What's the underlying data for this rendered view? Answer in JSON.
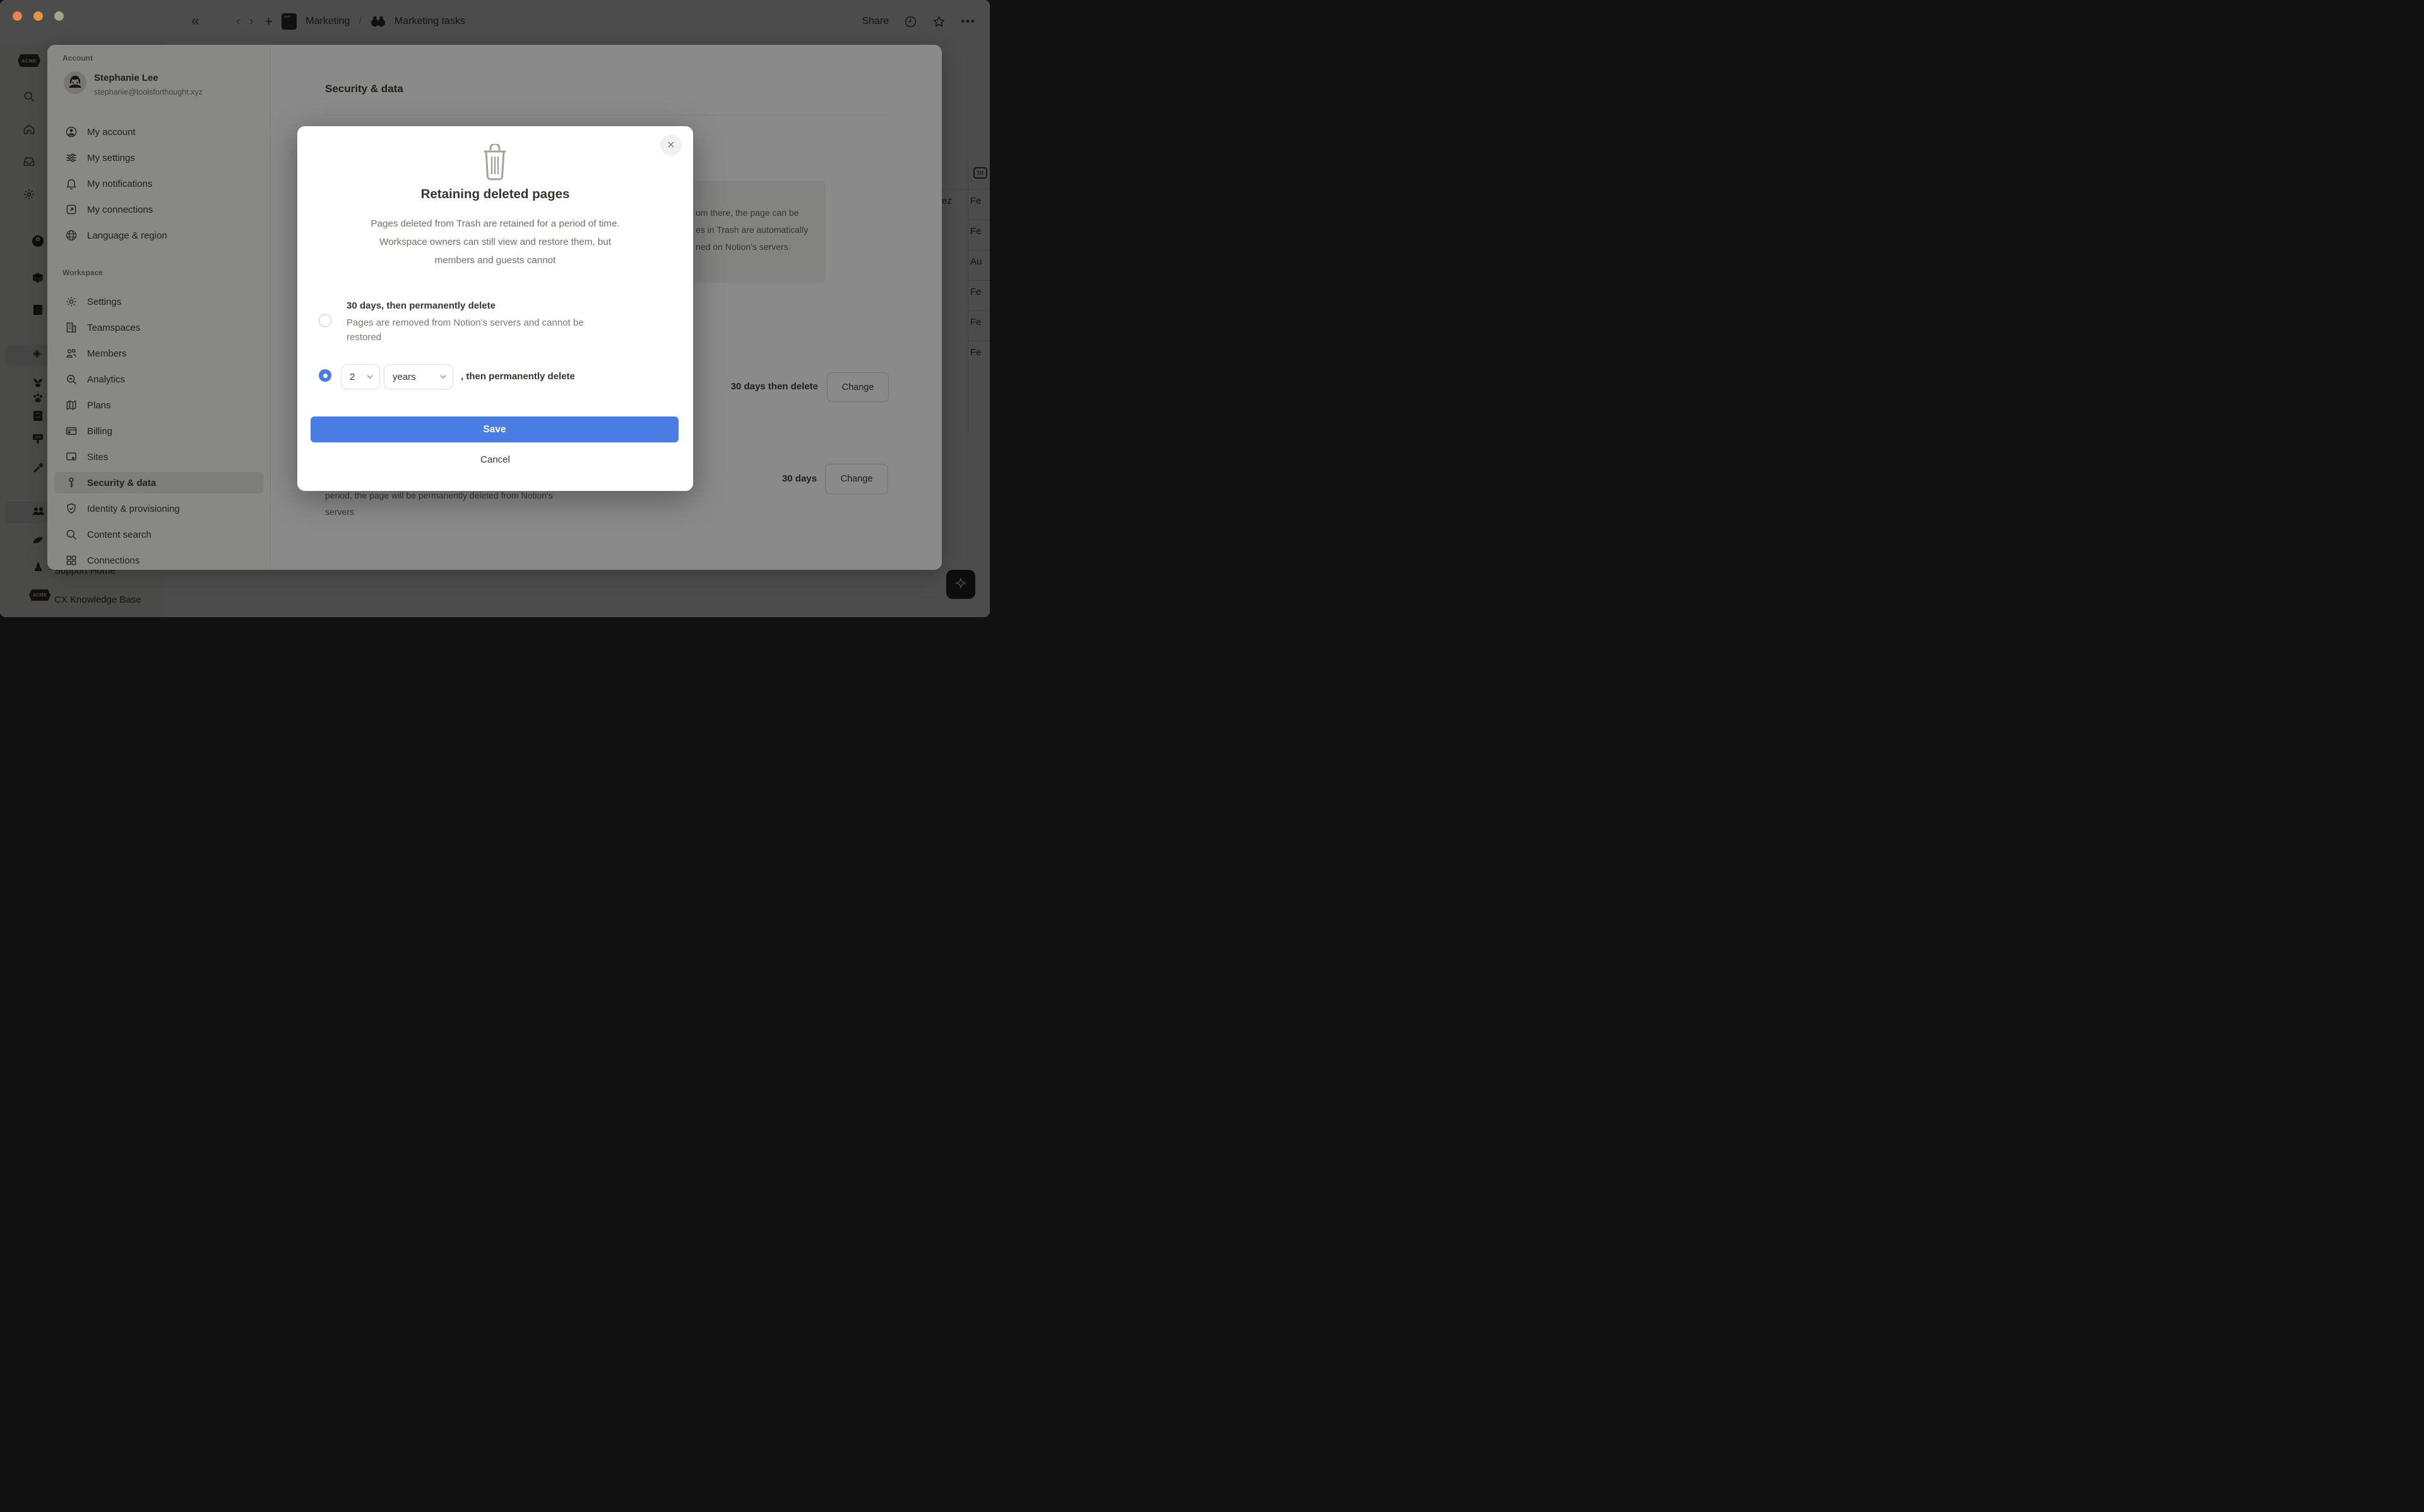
{
  "topbar": {
    "breadcrumb": {
      "page": "Marketing",
      "separator": "/",
      "subpage": "Marketing tasks"
    },
    "share_label": "Share"
  },
  "base_app": {
    "workspace_badge": "ACME",
    "sidebar_bottom_items": [
      {
        "label": "Support Home"
      },
      {
        "label": "CX Knowledge Base"
      }
    ],
    "table": {
      "name_fragment": "ez",
      "date_fragments": [
        "Fe",
        "Fe",
        "Au",
        "Fe",
        "Fe",
        "Fe"
      ]
    }
  },
  "settings": {
    "sidebar": {
      "account_label": "Account",
      "user": {
        "name": "Stephanie Lee",
        "email": "stephanie@toolsforthought.xyz"
      },
      "account_items": [
        {
          "label": "My account",
          "icon": "user-circle-icon"
        },
        {
          "label": "My settings",
          "icon": "sliders-icon"
        },
        {
          "label": "My notifications",
          "icon": "bell-icon"
        },
        {
          "label": "My connections",
          "icon": "external-link-icon"
        },
        {
          "label": "Language & region",
          "icon": "globe-icon"
        }
      ],
      "workspace_label": "Workspace",
      "workspace_items": [
        {
          "label": "Settings",
          "icon": "gear-icon",
          "selected": false
        },
        {
          "label": "Teamspaces",
          "icon": "building-icon",
          "selected": false
        },
        {
          "label": "Members",
          "icon": "members-icon",
          "selected": false
        },
        {
          "label": "Analytics",
          "icon": "analytics-icon",
          "selected": false
        },
        {
          "label": "Plans",
          "icon": "map-icon",
          "selected": false
        },
        {
          "label": "Billing",
          "icon": "credit-card-icon",
          "selected": false
        },
        {
          "label": "Sites",
          "icon": "browser-icon",
          "selected": false
        },
        {
          "label": "Security & data",
          "icon": "key-icon",
          "selected": true
        },
        {
          "label": "Identity & provisioning",
          "icon": "shield-check-icon",
          "selected": false
        },
        {
          "label": "Content search",
          "icon": "search-icon",
          "selected": false
        },
        {
          "label": "Connections",
          "icon": "grid-icon",
          "selected": false
        }
      ]
    },
    "content": {
      "title": "Security & data",
      "callout_visible_lines": [
        "om there, the page can be",
        "es in Trash are automatically",
        "ned on Notion's servers."
      ],
      "retention_row": {
        "value": "30 days then delete",
        "button_label": "Change"
      },
      "trash_row": {
        "value": "30 days",
        "button_label": "Change"
      },
      "below_dialog_lines": [
        "period, the page will be permanently deleted from Notion's",
        "servers"
      ]
    }
  },
  "dialog": {
    "title": "Retaining deleted pages",
    "description_lines": [
      "Pages deleted from Trash are retained for a period of time.",
      "Workspace owners can still view and restore them, but",
      "members and guests cannot"
    ],
    "options": [
      {
        "title": "30 days, then permanently delete",
        "subtitle_lines": [
          "Pages are removed from Notion's servers and cannot be",
          "restored"
        ],
        "selected": false
      },
      {
        "number": "2",
        "unit": "years",
        "suffix": ", then permanently delete",
        "selected": true
      }
    ],
    "save_label": "Save",
    "cancel_label": "Cancel"
  },
  "colors": {
    "accent_blue": "#4a7de4",
    "selected_item_bg": "#e8e8e6",
    "traffic_lights": [
      "#e5854e",
      "#e29544",
      "#97a88c"
    ]
  }
}
